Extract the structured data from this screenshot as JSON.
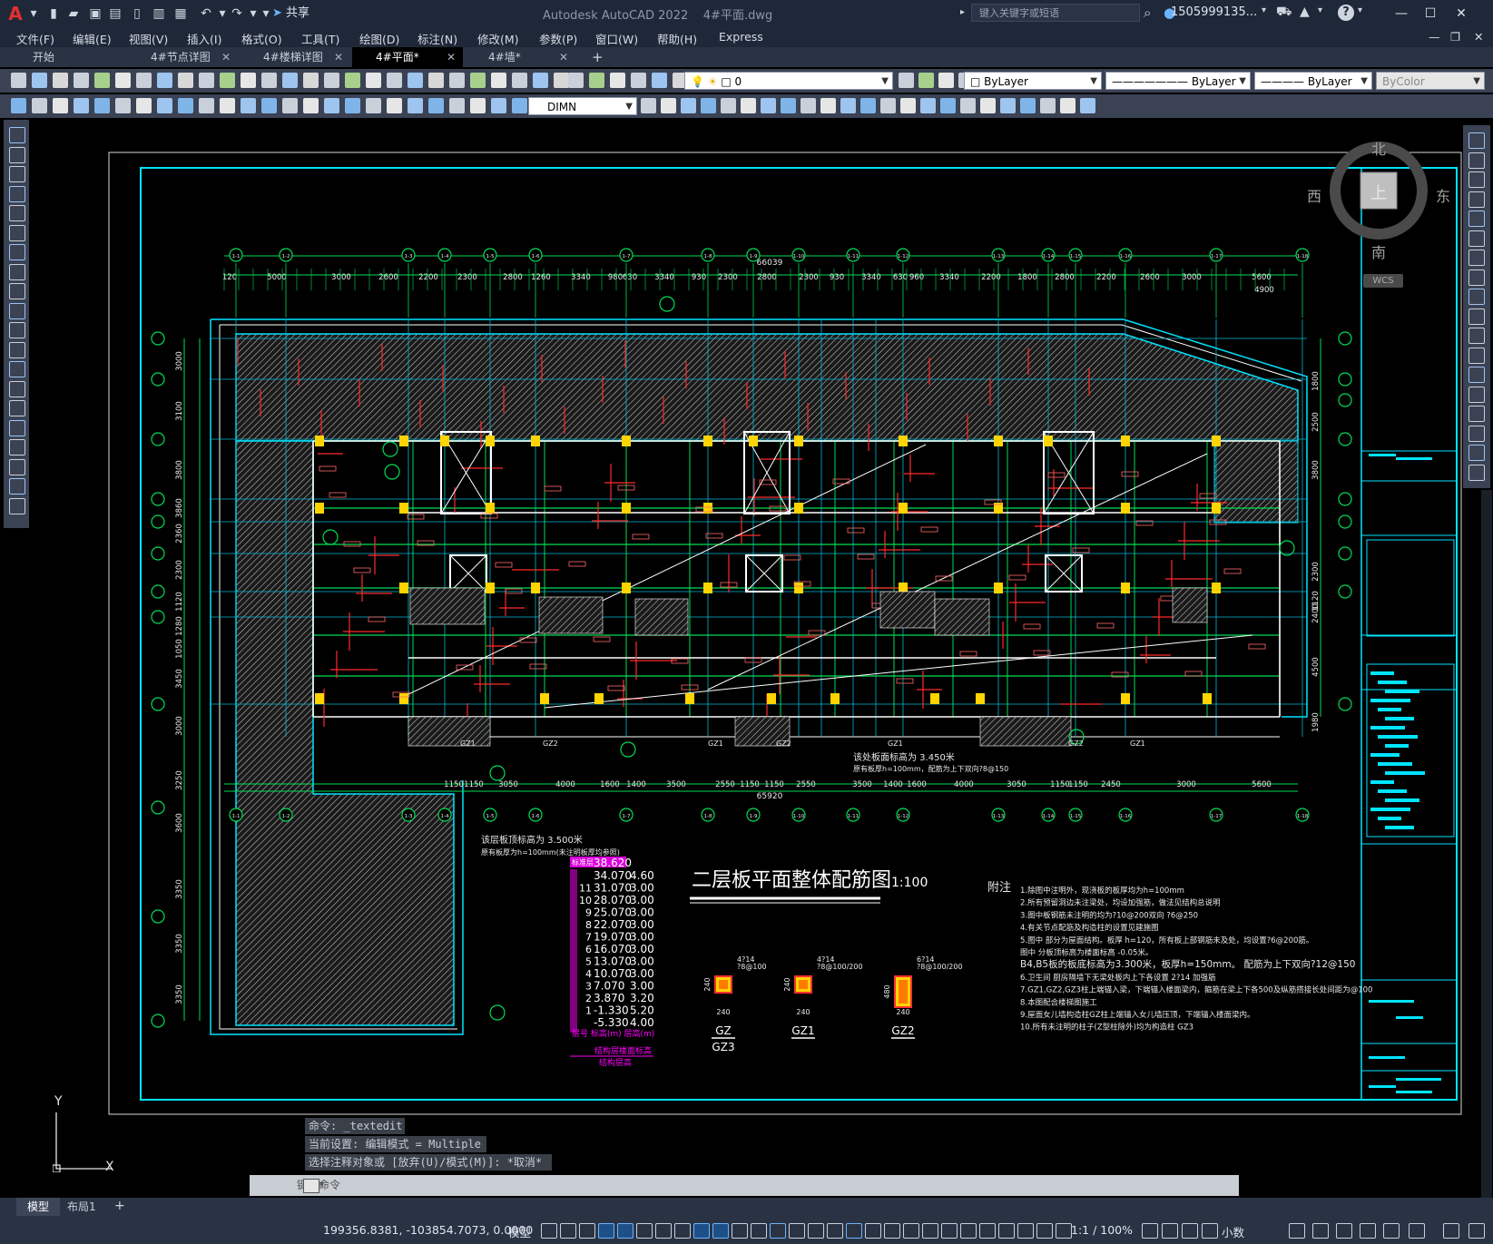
{
  "titlebar": {
    "app_title": "Autodesk AutoCAD 2022",
    "file_name": "4#平面.dwg",
    "share_label": "共享",
    "search_placeholder": "键入关键字或短语",
    "user_name": "1505999135...",
    "help_label": "?"
  },
  "menu": [
    "文件(F)",
    "编辑(E)",
    "视图(V)",
    "插入(I)",
    "格式(O)",
    "工具(T)",
    "绘图(D)",
    "标注(N)",
    "修改(M)",
    "参数(P)",
    "窗口(W)",
    "帮助(H)",
    "Express"
  ],
  "tabs": [
    {
      "label": "开始",
      "closable": false,
      "active": false
    },
    {
      "label": "4#节点详图",
      "closable": true,
      "active": false
    },
    {
      "label": "4#楼梯详图",
      "closable": true,
      "active": false
    },
    {
      "label": "4#平面*",
      "closable": true,
      "active": true
    },
    {
      "label": "4#墙*",
      "closable": true,
      "active": false
    }
  ],
  "toolbars": {
    "layer_value": "0",
    "color_value": "ByLayer",
    "linetype_value": "ByLayer",
    "lineweight_value": "ByLayer",
    "plotstyle_value": "ByColor",
    "dimstyle_value": "DIMN"
  },
  "viewcube": {
    "north": "北",
    "south": "南",
    "east": "东",
    "west": "西",
    "top": "上",
    "wcs": "WCS"
  },
  "drawing": {
    "title": "二层板平面整体配筋图",
    "scale": "1:100",
    "overall_top": "66039",
    "overall_bottom": "65920",
    "top_dims": [
      "120",
      "5000",
      "3000",
      "2600",
      "2200",
      "2300",
      "2800",
      "1260",
      "3340",
      "980",
      "630",
      "3340",
      "930",
      "2300",
      "2800",
      "2300",
      "930",
      "3340",
      "630",
      "960",
      "3340",
      "2200",
      "1800",
      "2800",
      "2200",
      "2600",
      "3000",
      "5600"
    ],
    "bottom_dims": [
      "1150",
      "1150",
      "3050",
      "4000",
      "1600",
      "1400",
      "3500",
      "2550",
      "1150",
      "1150",
      "2550",
      "3500",
      "1400",
      "1600",
      "4000",
      "3050",
      "1150",
      "1150",
      "2450",
      "3000",
      "5600"
    ],
    "left_dims": [
      "3000",
      "3100",
      "3800",
      "3860",
      "2360",
      "2300",
      "1120",
      "1280",
      "1050",
      "3450",
      "3000",
      "3250",
      "3600",
      "3350",
      "3350",
      "3350"
    ],
    "right_dims": [
      "1800",
      "2500",
      "3800",
      "2300",
      "1120",
      "2400",
      "4500",
      "1980"
    ],
    "grid_labels": [
      "1-1",
      "1-2",
      "1-3",
      "1-4",
      "1-5",
      "1-6",
      "1-7",
      "1-8",
      "1-9",
      "1-10",
      "1-11",
      "1-12",
      "1-13",
      "1-14",
      "1-15",
      "1-16",
      "1-17",
      "1-18",
      "1-19",
      "1-20"
    ],
    "floor_label": "标准层",
    "elev_header": "38.620",
    "elevations": [
      {
        "floor": "",
        "elev": "34.070",
        "h": "4.60"
      },
      {
        "floor": "11",
        "elev": "31.070",
        "h": "3.00"
      },
      {
        "floor": "10",
        "elev": "28.070",
        "h": "3.00"
      },
      {
        "floor": "9",
        "elev": "25.070",
        "h": "3.00"
      },
      {
        "floor": "8",
        "elev": "22.070",
        "h": "3.00"
      },
      {
        "floor": "7",
        "elev": "19.070",
        "h": "3.00"
      },
      {
        "floor": "6",
        "elev": "16.070",
        "h": "3.00"
      },
      {
        "floor": "5",
        "elev": "13.070",
        "h": "3.00"
      },
      {
        "floor": "4",
        "elev": "10.070",
        "h": "3.00"
      },
      {
        "floor": "3",
        "elev": "7.070",
        "h": "3.00"
      },
      {
        "floor": "2",
        "elev": "3.870",
        "h": "3.20"
      },
      {
        "floor": "1",
        "elev": "-1.330",
        "h": "5.20"
      },
      {
        "floor": "",
        "elev": "-5.330",
        "h": "4.00"
      }
    ],
    "elev_footer": "层号  标高(m)  层高(m)",
    "elev_caption": "结构层楼面标高",
    "elev_caption2": "结构层高",
    "slab_note1": "该层板顶标高为 3.500米",
    "slab_note2": "原有板厚为h=100mm(未注明板厚均参照)",
    "slab_note3": "该处板面标高为 3.450米",
    "slab_note4": "原有板厚h=100mm，配筋为上下双向?8@150",
    "notes_title": "附注",
    "notes": [
      "1.除图中注明外，现浇板的板厚均为h=100mm",
      "2.所有预留洞边未注梁处，均设加强筋，做法见结构总说明",
      "3.图中板钢筋未注明的均为?10@200双向   ?6@250",
      "4.有关节点配筋及构造柱的设置见建施图",
      "5.图中        部分为屋面结构。板厚 h=120，所有板上部钢筋未及处，均设置?6@200筋。",
      "   图中       分板顶标高为楼面标高  -0.05米。",
      "B4,B5板的板底标高为3.300米，板厚h=150mm。 配筋为上下双向?12@150",
      "6.卫生间 厨房隔墙下无梁处板内上下各设置 2?14 加强筋",
      "7.GZ1,GZ2,GZ3柱上端锚入梁，下端锚入楼面梁内，箍筋在梁上下各500及纵筋搭接长处间距为@100",
      "8.本图配合楼梯图施工",
      "9.屋面女儿墙构造柱GZ柱上端锚入女儿墙压顶，下端锚入楼面梁内。",
      "10.所有未注明的柱子(Z型柱除外)均为构造柱 GZ3"
    ],
    "col_sections": [
      {
        "name": "GZ",
        "sub": "GZ3",
        "bars": "4?14",
        "ties": "?8@100",
        "w": "240",
        "h": "240"
      },
      {
        "name": "GZ1",
        "sub": "",
        "bars": "4?14",
        "ties": "?8@100/200",
        "w": "240",
        "h": "240"
      },
      {
        "name": "GZ2",
        "sub": "",
        "bars": "6?14",
        "ties": "?8@100/200",
        "w": "240",
        "h": "480"
      }
    ],
    "side_labels": [
      "GZ1",
      "GZ2",
      "GZ1",
      "GZ2",
      "GZ1",
      "GZ2",
      "GZ1"
    ]
  },
  "command": {
    "line1": "命令:  _textedit",
    "line2": "当前设置: 编辑模式 = Multiple",
    "line3": "选择注释对象或 [放弃(U)/模式(M)]: *取消*",
    "input_placeholder": "键入命令"
  },
  "layout_tabs": [
    "模型",
    "布局1"
  ],
  "status": {
    "coords": "199356.8381, -103854.7073, 0.0000",
    "model": "模型",
    "scale": "1:1 / 100%",
    "units": "小数"
  },
  "ucs": {
    "x": "X",
    "y": "Y"
  }
}
